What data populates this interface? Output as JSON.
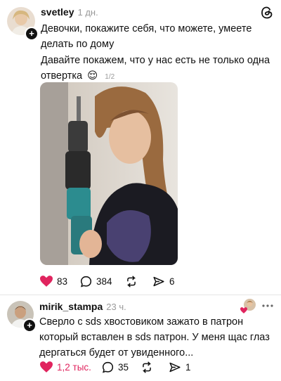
{
  "post": {
    "username": "svetley",
    "time": "1 дн.",
    "line1": "Девочки, покажите себя, что можете, умеете",
    "line2": "делать по дому",
    "line3": "Давайте покажем, что у нас есть не только одна",
    "line4": "отвертка",
    "emoji": "😌",
    "page_indicator": "1/2",
    "likes": "83",
    "comments": "384",
    "shares": "6"
  },
  "reply": {
    "username": "mirik_stampa",
    "time": "23 ч.",
    "line1": "Сверло с sds хвостовиком зажато в патрон",
    "line2": "который вставлен в sds патрон. У меня щас глаз",
    "line3": "дергаться будет от увиденного...",
    "likes": "1,2 тыс.",
    "comments": "35",
    "shares": "1"
  },
  "colors": {
    "like_red": "#e0245e",
    "muted": "#9a9a9a"
  },
  "icons": [
    "threads-logo-icon",
    "more-icon",
    "heart-icon",
    "comment-icon",
    "repost-icon",
    "share-icon",
    "plus-icon"
  ]
}
